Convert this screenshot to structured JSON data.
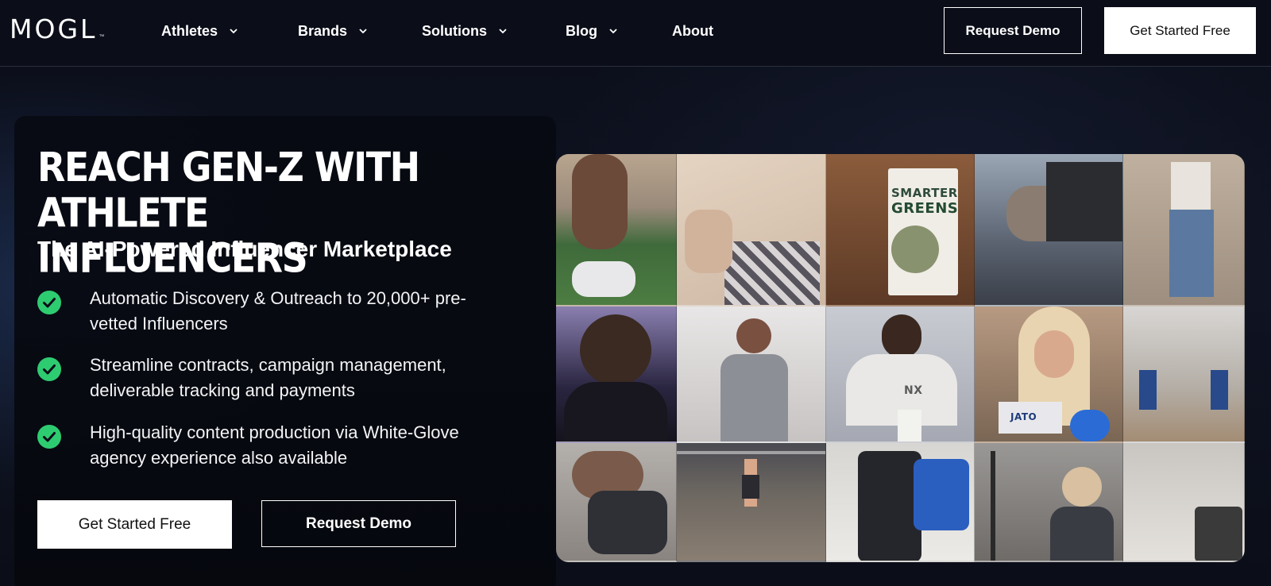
{
  "brand": {
    "name": "MOGL",
    "tm": "™"
  },
  "nav": {
    "items": [
      {
        "label": "Athletes",
        "dropdown": true
      },
      {
        "label": "Brands",
        "dropdown": true
      },
      {
        "label": "Solutions",
        "dropdown": true
      },
      {
        "label": "Blog",
        "dropdown": true
      },
      {
        "label": "About",
        "dropdown": false
      }
    ],
    "request_demo": "Request Demo",
    "get_started": "Get Started Free"
  },
  "hero": {
    "headline_line1": "REACH GEN-Z WITH",
    "headline_line2": "ATHLETE INFLUENCERS",
    "subhead": "The AI-Powered Influencer Marketplace",
    "features": [
      "Automatic Discovery & Outreach to 20,000+ pre-vetted Influencers",
      "Streamline contracts, campaign management, deliverable tracking and payments",
      "High-quality content production via White-Glove agency experience also available"
    ],
    "cta_primary": "Get Started Free",
    "cta_secondary": "Request Demo"
  },
  "collage": {
    "product_label_line1": "SMARTER",
    "product_label_line2": "GREENS",
    "jersey_text": "NX",
    "product_pack_text": "JATO"
  },
  "colors": {
    "background": "#0c0f1a",
    "check_green": "#2ecc71",
    "button_white": "#ffffff"
  }
}
